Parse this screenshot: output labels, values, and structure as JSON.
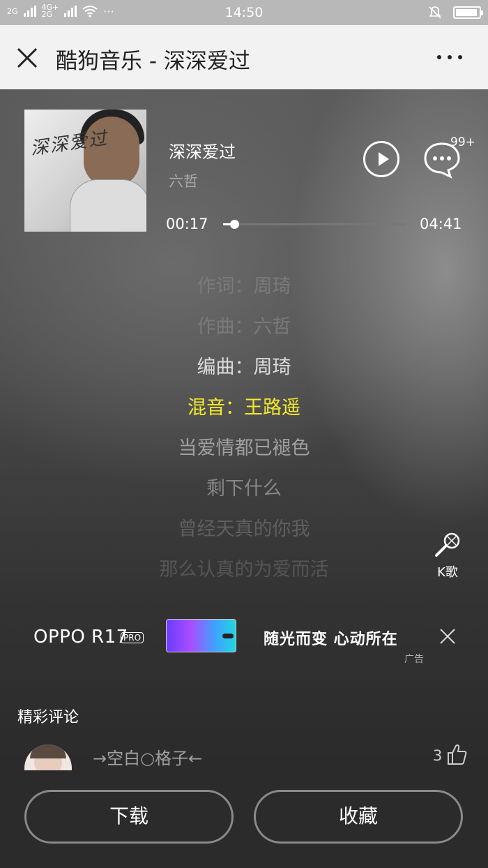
{
  "status_bar": {
    "net1": "2G",
    "net2_top": "4G+",
    "net2_bottom": "2G",
    "dots": "···",
    "time": "14:50",
    "battery_level": 0.95
  },
  "titlebar": {
    "title": "酷狗音乐 - 深深爱过"
  },
  "player": {
    "cover_text": "深深爱过",
    "song_title": "深深爱过",
    "artist": "六哲",
    "comment_count": "99+",
    "current_time": "00:17",
    "total_time": "04:41",
    "progress": 0.06
  },
  "lyrics": [
    "作词：周琦",
    "作曲：六哲",
    "编曲：周琦",
    "混音：王路遥",
    "当爱情都已褪色",
    "剩下什么",
    "曾经天真的你我",
    "那么认真的为爱而活"
  ],
  "kge_label": "K歌",
  "ad": {
    "brand": "OPPO R17",
    "pro_badge": "PRO",
    "slogan": "随光而变 心动所在",
    "tag": "广告"
  },
  "comments": {
    "title": "精彩评论",
    "items": [
      {
        "user": "→空白○格子←",
        "likes": "3"
      }
    ]
  },
  "bottom": {
    "download_label": "下载",
    "favorite_label": "收藏"
  },
  "colors": {
    "active_lyric": "#f6eb2b",
    "titlebar_bg": "#f2f2f2",
    "statusbar_bg": "#b8b8b8"
  }
}
